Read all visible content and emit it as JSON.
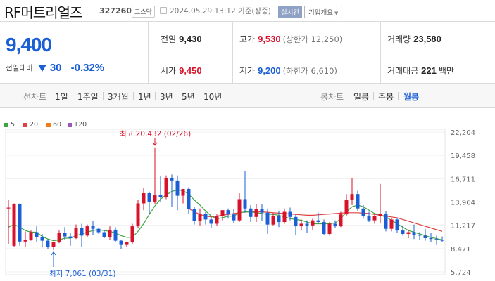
{
  "header": {
    "name": "RF머트리얼즈",
    "code": "327260",
    "market": "코스닥",
    "datetime": "2024.05.29 13:12 기준(장중)",
    "realtime": "실시간",
    "company_info": "기업개요"
  },
  "summary": {
    "price": "9,400",
    "change_label": "전일대비",
    "change": "30",
    "change_pct": "-0.32%",
    "prev_label": "전일",
    "prev": "9,430",
    "high_label": "고가",
    "high": "9,530",
    "upper_limit": "(상한가 12,250)",
    "volume_label": "거래량",
    "volume": "23,580",
    "open_label": "시가",
    "open": "9,450",
    "low_label": "저가",
    "low": "9,200",
    "lower_limit": "(하한가 6,610)",
    "amount_label": "거래대금",
    "amount": "221",
    "amount_unit": "백만"
  },
  "periods": {
    "line_label": "선차트",
    "line_items": [
      "1일",
      "1주일",
      "3개월",
      "1년",
      "3년",
      "5년",
      "10년"
    ],
    "candle_label": "봉차트",
    "candle_items": [
      "일봉",
      "주봉",
      "월봉"
    ],
    "active_candle": "월봉"
  },
  "colors": {
    "up": "#d9122c",
    "down": "#1a5fd6",
    "ma5": "#3ea63e",
    "ma20": "#e04040",
    "ma60": "#f07c1c",
    "ma120": "#9b59b6"
  },
  "chart_data": {
    "type": "candlestick",
    "legend": [
      {
        "name": "5",
        "color": "#3ea63e"
      },
      {
        "name": "20",
        "color": "#e04040"
      },
      {
        "name": "60",
        "color": "#f07c1c"
      },
      {
        "name": "120",
        "color": "#9b59b6"
      }
    ],
    "y_ticks": [
      "22,204",
      "19,458",
      "16,711",
      "13,964",
      "11,217",
      "8,471",
      "5,724"
    ],
    "ylim": [
      5724,
      22204
    ],
    "annotations": {
      "max_label": "최고 20,432 (02/26)",
      "min_label": "최저 7,061 (03/31)"
    },
    "candles": [
      [
        13200,
        14200,
        13300,
        9000
      ],
      [
        8800,
        13800,
        13700,
        8700
      ],
      [
        13700,
        13800,
        9300,
        8800
      ],
      [
        9300,
        10500,
        9500,
        8700
      ],
      [
        9500,
        10600,
        10400,
        9400
      ],
      [
        10400,
        11100,
        9800,
        9200
      ],
      [
        9800,
        10200,
        9400,
        8600
      ],
      [
        9400,
        9600,
        8700,
        8400
      ],
      [
        8700,
        9300,
        9200,
        8300
      ],
      [
        9200,
        10600,
        10300,
        9100
      ],
      [
        10300,
        11000,
        9900,
        9500
      ],
      [
        9900,
        10300,
        9700,
        8800
      ],
      [
        9700,
        11300,
        10900,
        9600
      ],
      [
        10900,
        11400,
        10000,
        8700
      ],
      [
        10000,
        11300,
        11100,
        9800
      ],
      [
        11100,
        11700,
        10800,
        10100
      ],
      [
        10800,
        10900,
        10400,
        10200
      ],
      [
        10400,
        10600,
        9800,
        9700
      ],
      [
        9800,
        11100,
        10700,
        9500
      ],
      [
        10700,
        11000,
        9400,
        9200
      ],
      [
        9400,
        9500,
        8900,
        8400
      ],
      [
        8900,
        9300,
        9200,
        8700
      ],
      [
        9200,
        11400,
        11100,
        9000
      ],
      [
        11100,
        14200,
        13800,
        10900
      ],
      [
        13800,
        15600,
        15000,
        13000
      ],
      [
        15000,
        15200,
        14000,
        12600
      ],
      [
        14000,
        20400,
        14800,
        13700
      ],
      [
        14800,
        17000,
        14500,
        14000
      ],
      [
        14500,
        17100,
        16800,
        14300
      ],
      [
        16800,
        17200,
        16500,
        13400
      ],
      [
        16500,
        17100,
        14700,
        13000
      ],
      [
        14700,
        14900,
        15500,
        13800
      ],
      [
        15500,
        15700,
        13100,
        12500
      ],
      [
        13100,
        13400,
        11700,
        11300
      ],
      [
        11700,
        13200,
        12600,
        11200
      ],
      [
        12600,
        12800,
        11900,
        11300
      ],
      [
        11900,
        12200,
        11400,
        10900
      ],
      [
        11400,
        12500,
        12300,
        11200
      ],
      [
        12300,
        12600,
        13000,
        11800
      ],
      [
        13000,
        13200,
        12500,
        12000
      ],
      [
        12500,
        13100,
        11800,
        11500
      ],
      [
        11800,
        15000,
        14300,
        11600
      ],
      [
        14300,
        17600,
        13200,
        12700
      ],
      [
        13200,
        13600,
        12200,
        11600
      ],
      [
        12200,
        13700,
        13100,
        11600
      ],
      [
        13100,
        13700,
        12700,
        11700
      ],
      [
        12700,
        13200,
        11300,
        10200
      ],
      [
        11300,
        12700,
        12300,
        11200
      ],
      [
        12300,
        12900,
        11600,
        11000
      ],
      [
        11600,
        13200,
        12800,
        11400
      ],
      [
        12800,
        13300,
        12200,
        11800
      ],
      [
        12200,
        12500,
        11100,
        10100
      ],
      [
        11100,
        11900,
        11400,
        10600
      ],
      [
        11400,
        11800,
        11200,
        10300
      ],
      [
        11200,
        12000,
        11800,
        10700
      ],
      [
        11800,
        12700,
        11600,
        11400
      ],
      [
        11600,
        11900,
        10200,
        10100
      ],
      [
        10200,
        11600,
        11400,
        10000
      ],
      [
        11400,
        11800,
        11100,
        10900
      ],
      [
        11100,
        12800,
        12500,
        11000
      ],
      [
        12500,
        14900,
        14200,
        12300
      ],
      [
        14200,
        16800,
        14900,
        13600
      ],
      [
        14900,
        15300,
        13200,
        12900
      ],
      [
        13200,
        13600,
        12300,
        12000
      ],
      [
        12300,
        12800,
        11800,
        11600
      ],
      [
        11800,
        12500,
        12300,
        11400
      ],
      [
        12300,
        16100,
        12600,
        11500
      ],
      [
        12600,
        12900,
        10800,
        10500
      ],
      [
        10800,
        12100,
        11900,
        10500
      ],
      [
        11900,
        12100,
        10600,
        10300
      ],
      [
        10600,
        11100,
        10200,
        10000
      ],
      [
        10200,
        10700,
        10400,
        9700
      ],
      [
        10400,
        11300,
        10100,
        9600
      ],
      [
        10100,
        10400,
        10000,
        9500
      ],
      [
        10000,
        10800,
        9700,
        9400
      ],
      [
        9700,
        10300,
        9600,
        9200
      ],
      [
        9600,
        10000,
        9500,
        8900
      ],
      [
        9500,
        9900,
        9400,
        9200
      ]
    ],
    "ma5": [
      11000,
      11300,
      11000,
      10600,
      10400,
      10400,
      9900,
      9600,
      9400,
      9500,
      9700,
      9700,
      10000,
      10200,
      10400,
      10600,
      10700,
      10600,
      10500,
      10300,
      10000,
      9800,
      9800,
      10500,
      11400,
      12500,
      13500,
      14300,
      14800,
      15200,
      15400,
      15300,
      14900,
      14200,
      13600,
      12900,
      12300,
      12000,
      12100,
      12300,
      12300,
      12700,
      12800,
      12800,
      12700,
      12600,
      12500,
      12500,
      12400,
      12200,
      12000,
      11900,
      11800,
      11600,
      11400,
      11400,
      11400,
      11400,
      11500,
      12000,
      12800,
      13400,
      13600,
      13400,
      13000,
      12600,
      12400,
      12200,
      11800,
      11400,
      11000,
      10600,
      10400,
      10200,
      10000,
      9800,
      9650,
      9500
    ],
    "ma20": [
      null,
      null,
      null,
      null,
      null,
      null,
      null,
      null,
      null,
      null,
      null,
      null,
      null,
      null,
      null,
      null,
      null,
      null,
      null,
      null,
      null,
      null,
      null,
      null,
      null,
      null,
      null,
      null,
      null,
      null,
      null,
      null,
      13200,
      12800,
      12500,
      12300,
      12200,
      12300,
      12400,
      12500,
      12600,
      12700,
      12800,
      12800,
      12800,
      12800,
      12750,
      12700,
      12650,
      12600,
      12550,
      12500,
      12450,
      12400,
      12400,
      12450,
      12500,
      12550,
      12600,
      12650,
      12700,
      12700,
      12700,
      12650,
      12600,
      12500,
      12400,
      12300,
      12200,
      12100,
      11900,
      11700,
      11500,
      11300,
      11100,
      10900,
      10700,
      10500
    ]
  }
}
